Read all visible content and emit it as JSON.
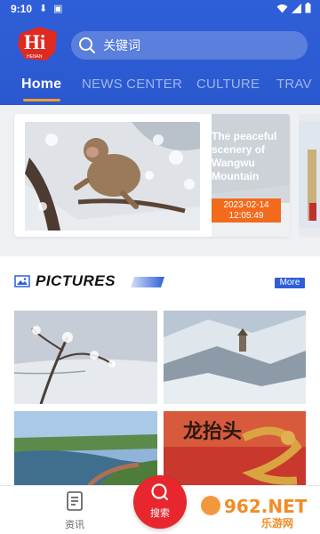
{
  "status_bar": {
    "time": "9:10"
  },
  "header": {
    "logo_text": "Hi",
    "logo_subtext": "HENAN",
    "search_placeholder": "关键词"
  },
  "tabs": [
    {
      "label": "Home",
      "active": true
    },
    {
      "label": "NEWS CENTER",
      "active": false
    },
    {
      "label": "CULTURE",
      "active": false
    },
    {
      "label": "TRAV",
      "active": false
    }
  ],
  "featured": {
    "title": "The peaceful scenery of Wangwu Mountain",
    "date": "2023-02-14",
    "time": "12:05:49"
  },
  "pictures": {
    "title": "PICTURES",
    "more_label": "More",
    "thumb_text": "龙抬头"
  },
  "bottom_nav": {
    "news_label": "资讯",
    "search_label": "搜索"
  },
  "watermark": {
    "text": "962.NET",
    "subtext": "乐游网"
  },
  "colors": {
    "header_blue": "#2f5fd8",
    "tab_underline": "#f29b2b",
    "date_badge": "#f26b1d",
    "search_button": "#e8262d"
  }
}
